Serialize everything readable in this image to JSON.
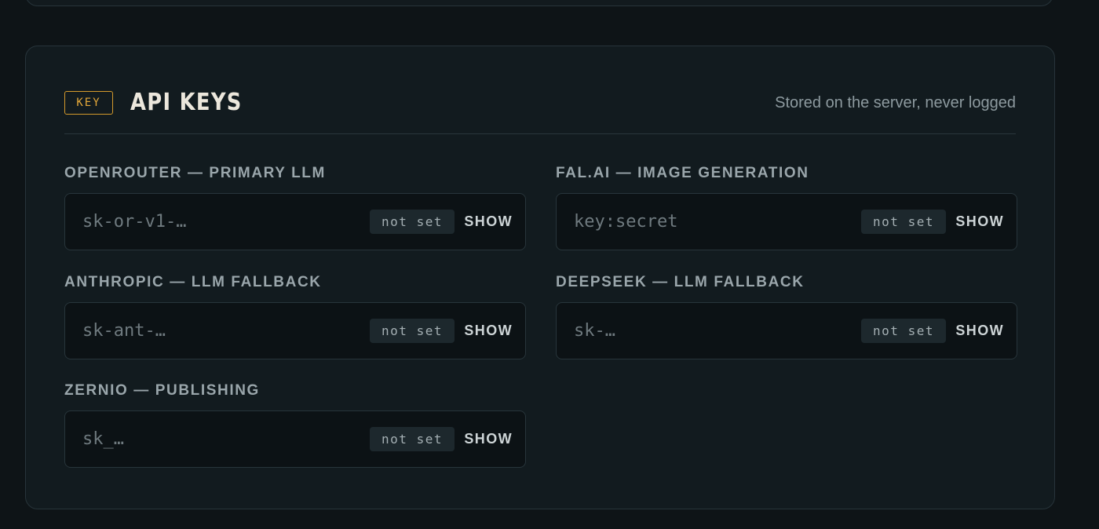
{
  "section": {
    "badge": "KEY",
    "title": "API KEYS",
    "subtitle": "Stored on the server, never logged"
  },
  "fields": [
    {
      "label": "OPENROUTER — PRIMARY LLM",
      "placeholder": "sk-or-v1-…",
      "value": "",
      "status": "not set",
      "toggle": "SHOW"
    },
    {
      "label": "FAL.AI — IMAGE GENERATION",
      "placeholder": "key:secret",
      "value": "",
      "status": "not set",
      "toggle": "SHOW"
    },
    {
      "label": "ANTHROPIC — LLM FALLBACK",
      "placeholder": "sk-ant-…",
      "value": "",
      "status": "not set",
      "toggle": "SHOW"
    },
    {
      "label": "DEEPSEEK — LLM FALLBACK",
      "placeholder": "sk-…",
      "value": "",
      "status": "not set",
      "toggle": "SHOW"
    },
    {
      "label": "ZERNIO — PUBLISHING",
      "placeholder": "sk_…",
      "value": "",
      "status": "not set",
      "toggle": "SHOW"
    }
  ]
}
